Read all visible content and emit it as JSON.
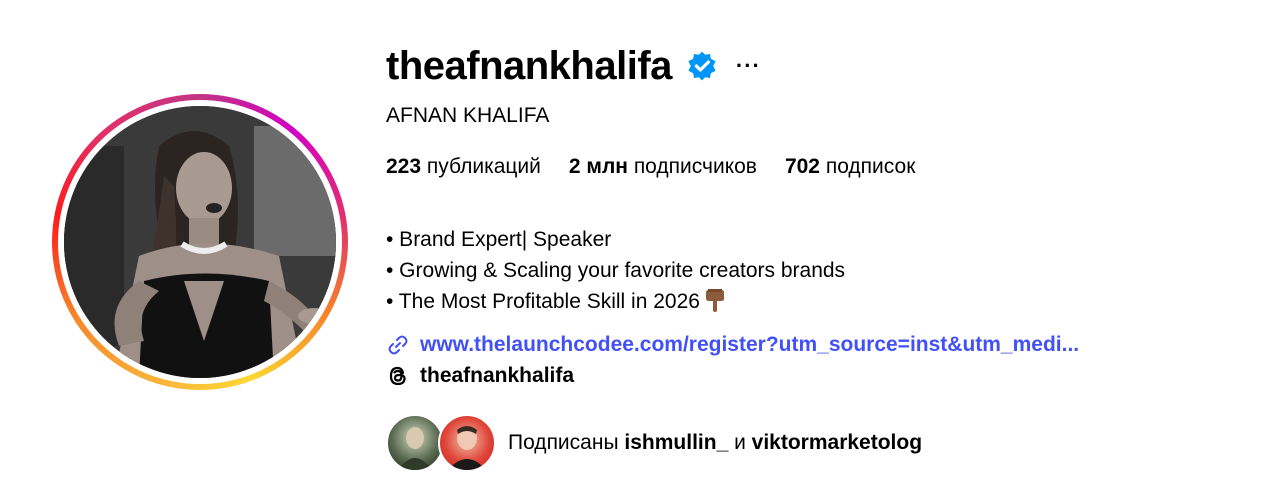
{
  "profile": {
    "username": "theafnankhalifa",
    "full_name": "AFNAN KHALIFA",
    "verified_icon": "verified-badge-icon",
    "more_label": "···"
  },
  "stats": {
    "posts_count": "223",
    "posts_label": "публикаций",
    "followers_count": "2 млн",
    "followers_label": "подписчиков",
    "following_count": "702",
    "following_label": "подписок"
  },
  "bio": {
    "lines": [
      "• Brand Expert| Speaker",
      "• Growing & Scaling your favorite creators brands",
      "• The Most Profitable Skill in 2026"
    ],
    "line3_emoji": "pointing-down-hand-icon"
  },
  "link": {
    "text": "www.thelaunchcodee.com/register?utm_source=inst&utm_medi...",
    "icon": "link-icon"
  },
  "threads": {
    "handle": "theafnankhalifa",
    "icon": "threads-icon"
  },
  "followed_by": {
    "prefix": "Подписаны",
    "user1": "ishmullin_",
    "conjunction": "и",
    "user2": "viktormarketolog"
  },
  "colors": {
    "link": "#4150f7",
    "verified": "#0095f6",
    "text": "#000000"
  }
}
